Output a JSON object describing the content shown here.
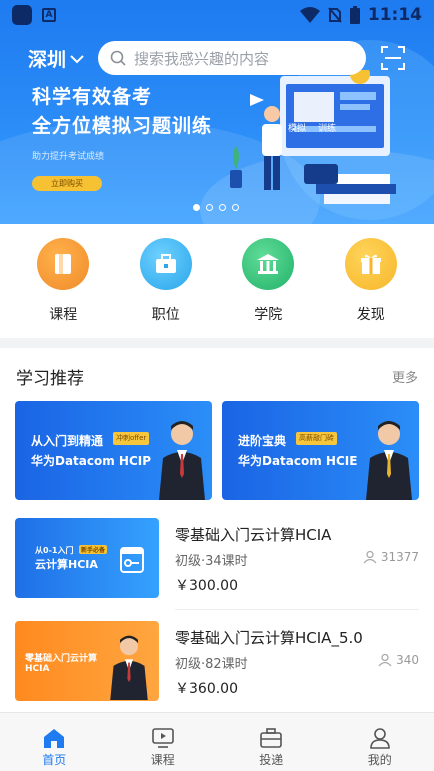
{
  "status": {
    "time": "11:14"
  },
  "header": {
    "city": "深圳",
    "search_placeholder": "搜索我感兴趣的内容"
  },
  "banner": {
    "title_line1": "科学有效备考",
    "title_line2": "全方位模拟习题训练",
    "subtitle": "助力提升考试成绩",
    "button": "立即购买",
    "screen_text_1": "模拟",
    "screen_text_2": "训练",
    "slide_count": 4,
    "active_slide": 0
  },
  "quick_nav": [
    {
      "label": "课程",
      "icon": "book-icon",
      "color": "#f08a2a"
    },
    {
      "label": "职位",
      "icon": "briefcase-icon",
      "color": "#2aa6ea"
    },
    {
      "label": "学院",
      "icon": "school-icon",
      "color": "#23b26a"
    },
    {
      "label": "发现",
      "icon": "gift-icon",
      "color": "#f6b62a"
    }
  ],
  "recommend": {
    "title": "学习推荐",
    "more": "更多",
    "promos": [
      {
        "line1": "从入门到精通",
        "tag": "冲刺offer",
        "line2": "华为Datacom HCIP"
      },
      {
        "line1": "进阶宝典",
        "tag": "高薪敲门砖",
        "line2": "华为Datacom HCIE"
      }
    ],
    "courses": [
      {
        "title": "零基础入门云计算HCIA",
        "level": "初级·34课时",
        "count": "31377",
        "price": "￥300.00",
        "thumb_line1": "从0-1入门",
        "thumb_tag": "新手必备",
        "thumb_line2": "云计算HCIA"
      },
      {
        "title": "零基础入门云计算HCIA_5.0",
        "level": "初级·82课时",
        "count": "340",
        "price": "￥360.00",
        "thumb_line1": "零基础入门云计算",
        "thumb_line2": "HCIA"
      }
    ]
  },
  "tabbar": [
    {
      "label": "首页",
      "icon": "home-icon",
      "active": true
    },
    {
      "label": "课程",
      "icon": "video-icon",
      "active": false
    },
    {
      "label": "投递",
      "icon": "briefcase-icon",
      "active": false
    },
    {
      "label": "我的",
      "icon": "user-icon",
      "active": false
    }
  ],
  "colors": {
    "accent": "#1e7bf0",
    "price": "#222222"
  }
}
